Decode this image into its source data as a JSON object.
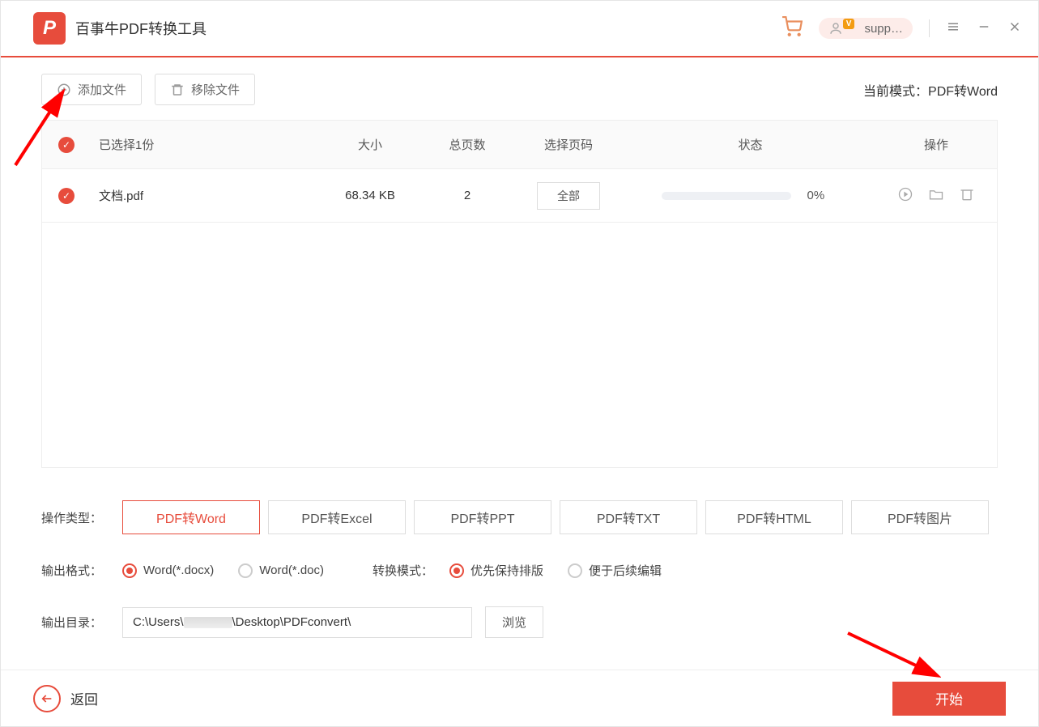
{
  "header": {
    "app_title": "百事牛PDF转换工具",
    "user_label": "supp…"
  },
  "toolbar": {
    "add_file": "添加文件",
    "remove_file": "移除文件",
    "mode_prefix": "当前模式：",
    "mode_value": "PDF转Word"
  },
  "table": {
    "headers": {
      "selected": "已选择1份",
      "size": "大小",
      "pages": "总页数",
      "select_pages": "选择页码",
      "status": "状态",
      "ops": "操作"
    },
    "rows": [
      {
        "name": "文档.pdf",
        "size": "68.34 KB",
        "pages": "2",
        "select_label": "全部",
        "pct": "0%"
      }
    ]
  },
  "options": {
    "type_label": "操作类型：",
    "types": [
      "PDF转Word",
      "PDF转Excel",
      "PDF转PPT",
      "PDF转TXT",
      "PDF转HTML",
      "PDF转图片"
    ],
    "format_label": "输出格式：",
    "formats": [
      "Word(*.docx)",
      "Word(*.doc)"
    ],
    "mode_label": "转换模式：",
    "modes": [
      "优先保持排版",
      "便于后续编辑"
    ],
    "dir_label": "输出目录：",
    "dir_prefix": "C:\\Users\\",
    "dir_suffix": "\\Desktop\\PDFconvert\\",
    "browse": "浏览"
  },
  "footer": {
    "back": "返回",
    "start": "开始"
  }
}
